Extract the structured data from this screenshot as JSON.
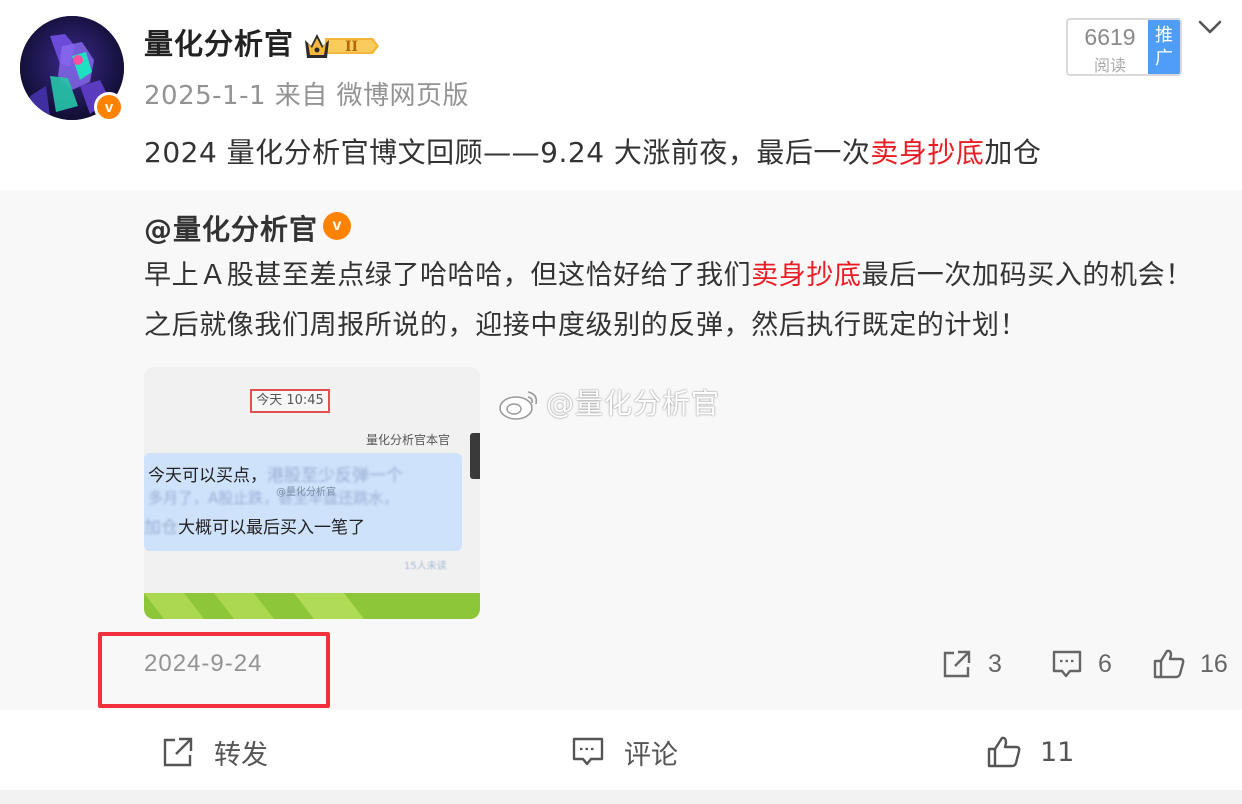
{
  "post": {
    "author": "量化分析官",
    "meta": "2025-1-1 来自 微博网页版",
    "text_before": "2024 量化分析官博文回顾——9.24 大涨前夜，最后一次",
    "text_highlight": "卖身抄底",
    "text_after": "加仓",
    "read_count": "6619",
    "read_label": "阅读",
    "promote_label": "推广"
  },
  "repost": {
    "author": "@量化分析官",
    "line1_before": "早上Ａ股甚至差点绿了哈哈哈，但这恰好给了我们",
    "line1_highlight": "卖身抄底",
    "line1_after": "最后一次加码买入的机会！",
    "line2": "之后就像我们周报所说的，迎接中度级别的反弹，然后执行既定的计划！",
    "watermark": "@量化分析官",
    "date": "2024-9-24",
    "shares": "3",
    "comments": "6",
    "likes": "16",
    "image": {
      "time_label": "今天 10:45",
      "sender": "量化分析官本官",
      "line1": "今天可以买点，",
      "line1_blur": "港股至少反弹一个",
      "line2_blur": "多月了，A股止跌，甚至早盘还跳水，",
      "line3_blur": "加仓",
      "line3": "大概可以最后买入一笔了",
      "read_info": "15人未读",
      "inner_watermark": "@量化分析官"
    }
  },
  "toolbar": {
    "forward_label": "转发",
    "comment_label": "评论",
    "like_count": "11"
  },
  "colors": {
    "highlight": "#eb1d24",
    "badge_orange": "#ff8200",
    "promote_blue": "#4f9df7",
    "annotation_red": "#f2313b"
  }
}
